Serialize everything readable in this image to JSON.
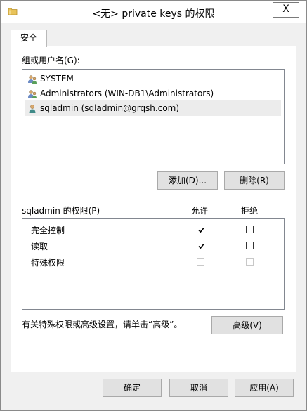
{
  "window": {
    "title": "<无> private keys 的权限",
    "close_label": "X"
  },
  "tabs": [
    {
      "label": "安全"
    }
  ],
  "security": {
    "group_label": "组或用户名(G):",
    "principals": [
      {
        "name": "SYSTEM",
        "icon": "group-users-icon"
      },
      {
        "name": "Administrators (WIN-DB1\\Administrators)",
        "icon": "group-users-icon"
      },
      {
        "name": "sqladmin (sqladmin@grqsh.com)",
        "icon": "user-icon",
        "selected": true
      }
    ],
    "add_button": "添加(D)...",
    "remove_button": "删除(R)",
    "permissions_label": "sqladmin 的权限(P)",
    "allow_header": "允许",
    "deny_header": "拒绝",
    "permissions": [
      {
        "name": "完全控制",
        "allow": true,
        "deny": false,
        "enabled": true
      },
      {
        "name": "读取",
        "allow": true,
        "deny": false,
        "enabled": true
      },
      {
        "name": "特殊权限",
        "allow": false,
        "deny": false,
        "enabled": false
      }
    ],
    "advanced_note": "有关特殊权限或高级设置，请单击“高级”。",
    "advanced_button": "高级(V)"
  },
  "footer": {
    "ok_button": "确定",
    "cancel_button": "取消",
    "apply_button": "应用(A)"
  }
}
